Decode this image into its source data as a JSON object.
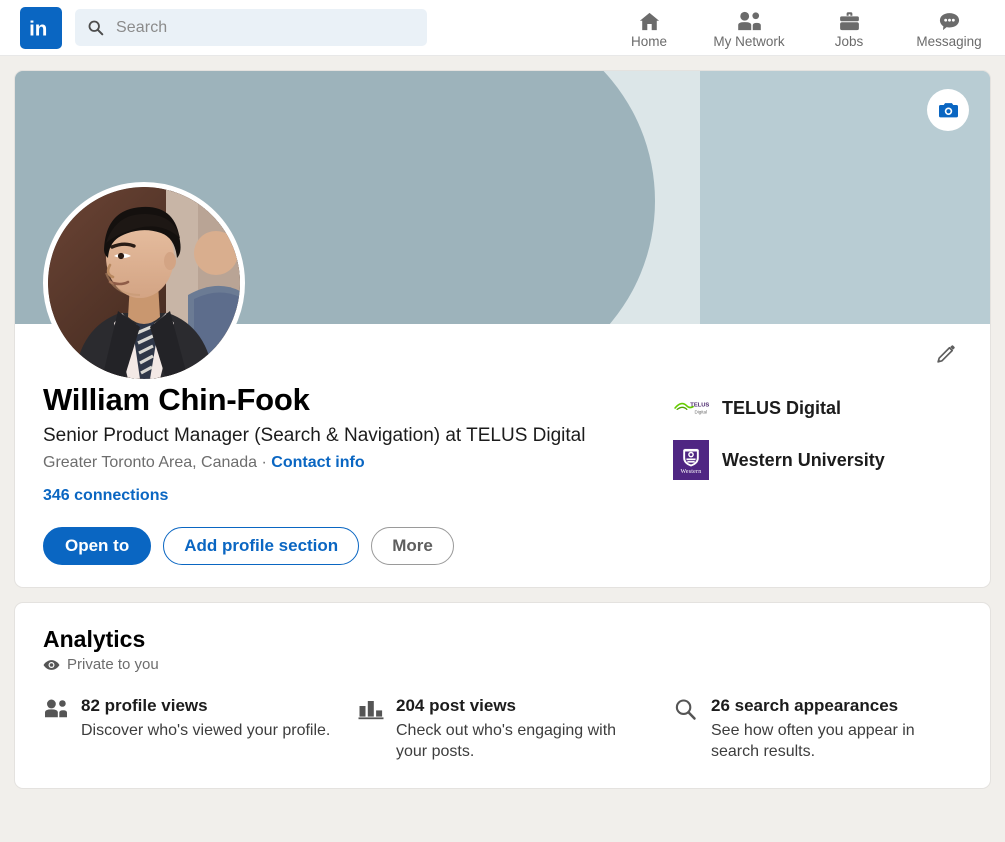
{
  "nav": {
    "logo_icon": "linkedin-logo",
    "search": {
      "placeholder": "Search",
      "value": "",
      "icon": "search-icon"
    },
    "items": [
      {
        "label": "Home",
        "icon": "home-icon"
      },
      {
        "label": "My Network",
        "icon": "people-icon"
      },
      {
        "label": "Jobs",
        "icon": "briefcase-icon"
      },
      {
        "label": "Messaging",
        "icon": "message-bubble-icon"
      }
    ]
  },
  "profile": {
    "banner": {
      "camera_icon": "camera-icon",
      "color_left": "#9db3bb",
      "color_mid": "#dce6e8",
      "color_right": "#b8ccd3"
    },
    "avatar_alt": "profile-photo",
    "edit_icon": "pencil-icon",
    "name": "William Chin-Fook",
    "headline": "Senior Product Manager (Search & Navigation) at TELUS Digital",
    "location": "Greater Toronto Area, Canada",
    "separator": "·",
    "contact_info": "Contact info",
    "connections": "346 connections",
    "buttons": [
      {
        "label": "Open to",
        "style": "primary"
      },
      {
        "label": "Add profile section",
        "style": "outline-blue"
      },
      {
        "label": "More",
        "style": "outline-gray"
      }
    ],
    "organizations": [
      {
        "name": "TELUS Digital",
        "logo": "telus-digital-logo"
      },
      {
        "name": "Western University",
        "logo": "western-university-logo"
      }
    ]
  },
  "analytics": {
    "title": "Analytics",
    "privacy_icon": "eye-icon",
    "privacy_label": "Private to you",
    "stats": [
      {
        "icon": "people-icon",
        "headline": "82 profile views",
        "description": "Discover who's viewed your profile."
      },
      {
        "icon": "bar-chart-icon",
        "headline": "204 post views",
        "description": "Check out who's engaging with your posts."
      },
      {
        "icon": "search-icon",
        "headline": "26 search appearances",
        "description": "See how often you appear in search results."
      }
    ]
  },
  "colors": {
    "brand_blue": "#0a66c2",
    "page_bg": "#f1efeb",
    "card_bg": "#ffffff",
    "western_purple": "#4f2683",
    "telus_green": "#66cc00"
  }
}
